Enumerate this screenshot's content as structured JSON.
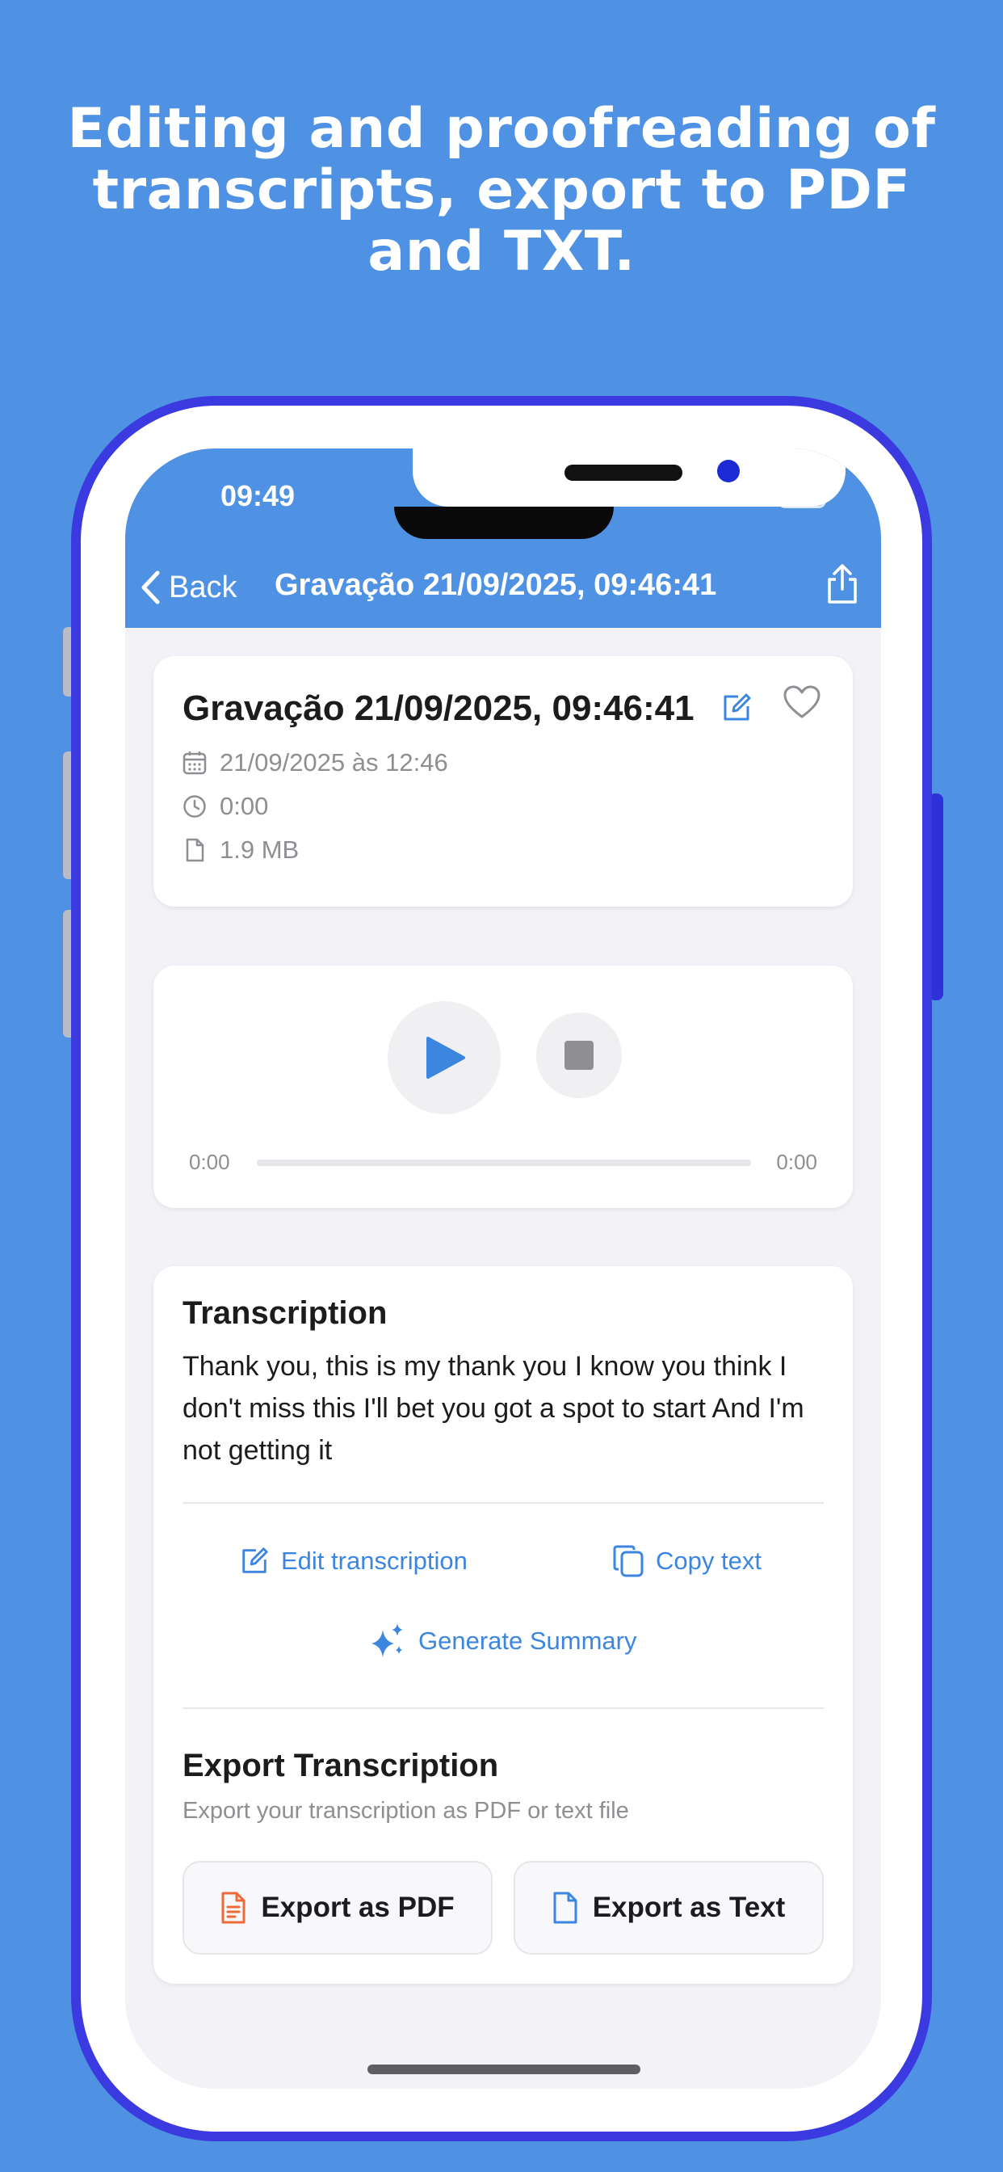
{
  "headline": "Editing and proofreading of transcripts, export to PDF and TXT.",
  "status_bar": {
    "time": "09:49"
  },
  "nav": {
    "back_label": "Back",
    "title": "Gravação 21/09/2025, 09:46:41"
  },
  "recording": {
    "title": "Gravação 21/09/2025, 09:46:41",
    "date": "21/09/2025 às 12:46",
    "duration": "0:00",
    "size": "1.9 MB"
  },
  "player": {
    "current_time": "0:00",
    "total_time": "0:00",
    "progress": 0
  },
  "transcription": {
    "heading": "Transcription",
    "text": " Thank you, this is my thank you I know you think I don't miss this I'll bet you got a spot to start And I'm not getting it",
    "edit_label": "Edit transcription",
    "copy_label": "Copy text",
    "summary_label": "Generate Summary"
  },
  "export": {
    "heading": "Export Transcription",
    "subtitle": "Export your transcription as PDF or text file",
    "pdf_label": "Export as PDF",
    "text_label": "Export as Text"
  },
  "colors": {
    "brand_blue": "#4f92e3",
    "accent_blue": "#3d86e0",
    "pdf_orange": "#ef6a3a",
    "phone_frame": "#3b3ae0"
  },
  "icons": [
    "back-chevron-icon",
    "share-icon",
    "edit-icon",
    "heart-icon",
    "calendar-icon",
    "clock-icon",
    "file-icon",
    "play-icon",
    "stop-icon",
    "copy-icon",
    "sparkles-icon",
    "pdf-file-icon",
    "text-file-icon",
    "wifi-icon",
    "battery-icon",
    "signal-icon"
  ]
}
